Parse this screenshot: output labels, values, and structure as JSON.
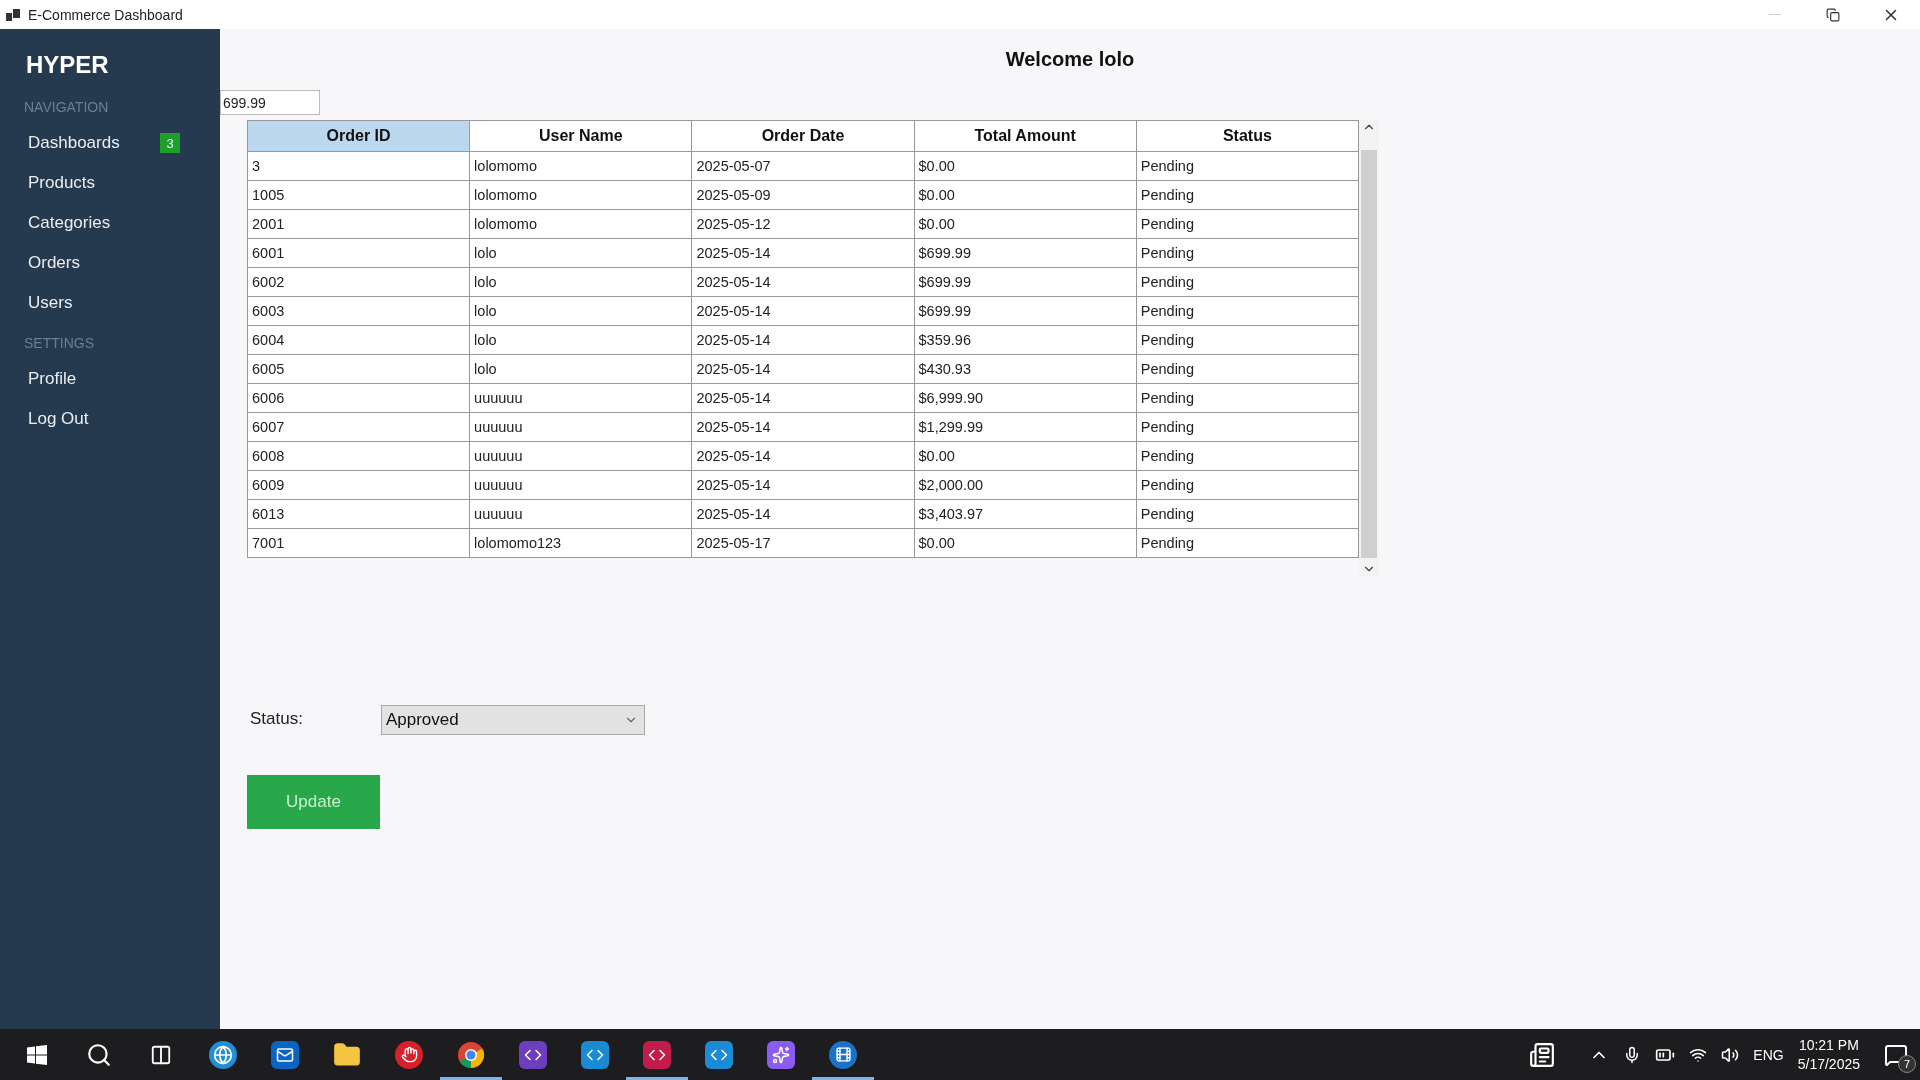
{
  "window": {
    "title": "E-Commerce Dashboard"
  },
  "sidebar": {
    "brand": "HYPER",
    "sections": [
      {
        "heading": "NAVIGATION",
        "items": [
          {
            "label": "Dashboards",
            "badge": "3"
          },
          {
            "label": "Products"
          },
          {
            "label": "Categories"
          },
          {
            "label": "Orders"
          },
          {
            "label": "Users"
          }
        ]
      },
      {
        "heading": "SETTINGS",
        "items": [
          {
            "label": "Profile"
          },
          {
            "label": "Log Out"
          }
        ]
      }
    ]
  },
  "header": {
    "title": "Welcome lolo"
  },
  "amount_field": {
    "value": "699.99"
  },
  "table": {
    "columns": [
      {
        "label": "Order ID",
        "selected": true
      },
      {
        "label": "User Name",
        "selected": false
      },
      {
        "label": "Order Date",
        "selected": false
      },
      {
        "label": "Total Amount",
        "selected": false
      },
      {
        "label": "Status",
        "selected": false
      }
    ],
    "rows": [
      [
        "3",
        "lolomomo",
        "2025-05-07",
        "$0.00",
        "Pending"
      ],
      [
        "1005",
        "lolomomo",
        "2025-05-09",
        "$0.00",
        "Pending"
      ],
      [
        "2001",
        "lolomomo",
        "2025-05-12",
        "$0.00",
        "Pending"
      ],
      [
        "6001",
        "lolo",
        "2025-05-14",
        "$699.99",
        "Pending"
      ],
      [
        "6002",
        "lolo",
        "2025-05-14",
        "$699.99",
        "Pending"
      ],
      [
        "6003",
        "lolo",
        "2025-05-14",
        "$699.99",
        "Pending"
      ],
      [
        "6004",
        "lolo",
        "2025-05-14",
        "$359.96",
        "Pending"
      ],
      [
        "6005",
        "lolo",
        "2025-05-14",
        "$430.93",
        "Pending"
      ],
      [
        "6006",
        "uuuuuu",
        "2025-05-14",
        "$6,999.90",
        "Pending"
      ],
      [
        "6007",
        "uuuuuu",
        "2025-05-14",
        "$1,299.99",
        "Pending"
      ],
      [
        "6008",
        "uuuuuu",
        "2025-05-14",
        "$0.00",
        "Pending"
      ],
      [
        "6009",
        "uuuuuu",
        "2025-05-14",
        "$2,000.00",
        "Pending"
      ],
      [
        "6013",
        "uuuuuu",
        "2025-05-14",
        "$3,403.97",
        "Pending"
      ],
      [
        "7001",
        "lolomomo123",
        "2025-05-17",
        "$0.00",
        "Pending"
      ]
    ]
  },
  "status_form": {
    "label": "Status:",
    "value": "Approved",
    "button": "Update"
  },
  "taskbar": {
    "apps": [
      {
        "running": false
      },
      {
        "running": false
      },
      {
        "running": false
      },
      {
        "running": false
      },
      {
        "running": false
      },
      {
        "running": false
      },
      {
        "running": false
      },
      {
        "running": true
      },
      {
        "running": false
      },
      {
        "running": false
      },
      {
        "running": true
      },
      {
        "running": false
      },
      {
        "running": false
      },
      {
        "running": true
      }
    ],
    "language": "ENG",
    "time": "10:21 PM",
    "date": "5/17/2025",
    "notifications": "7"
  }
}
